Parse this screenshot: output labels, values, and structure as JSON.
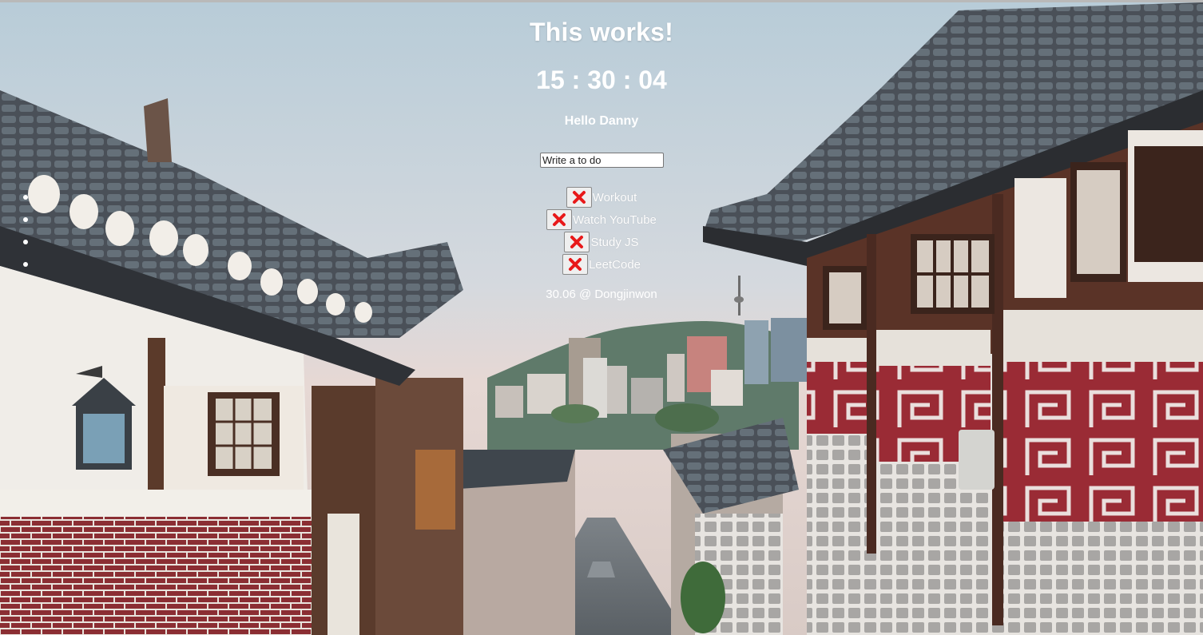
{
  "page": {
    "title": "This works!",
    "clock": "15 : 30 : 04",
    "greeting": "Hello Danny",
    "footer": "30.06 @ Dongjinwon"
  },
  "todo_form": {
    "placeholder": "Write a to do"
  },
  "todos": [
    {
      "text": "Workout",
      "delete_icon": "red-x-icon"
    },
    {
      "text": "Watch YouTube",
      "delete_icon": "red-x-icon"
    },
    {
      "text": "Study JS",
      "delete_icon": "red-x-icon"
    },
    {
      "text": "LeetCode",
      "delete_icon": "red-x-icon"
    }
  ],
  "colors": {
    "text": "#ffffff",
    "delete_icon": "#e8191a",
    "button_bg": "#efefef",
    "sky_top": "#b5cbd8",
    "sky_bottom": "#e6d7d3"
  }
}
